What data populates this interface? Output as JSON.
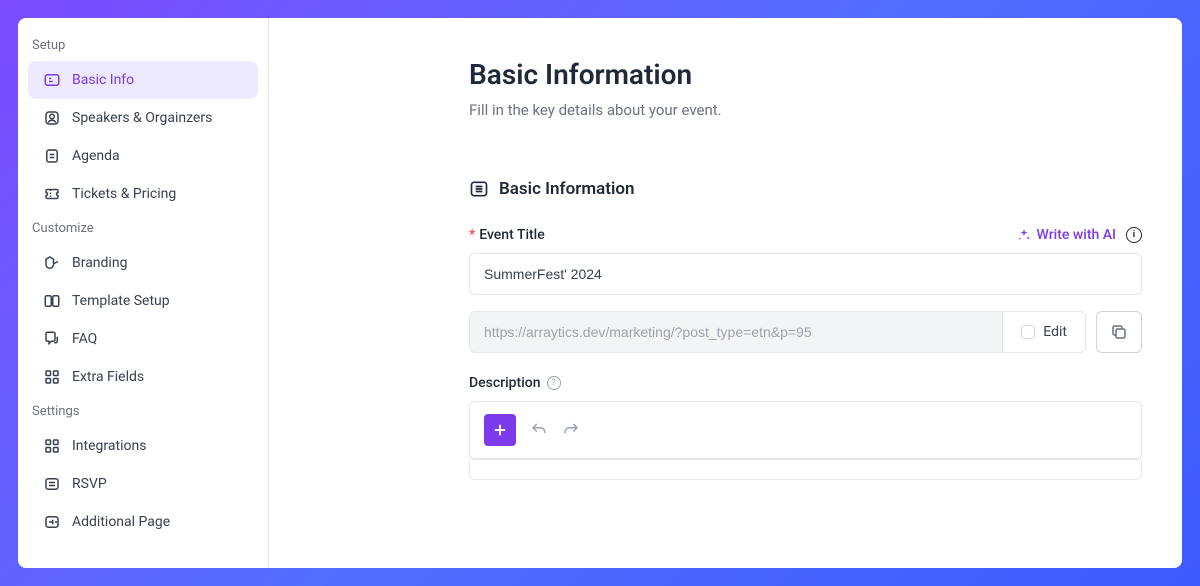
{
  "sidebar": {
    "sections": [
      {
        "header": "Setup",
        "items": [
          {
            "label": "Basic Info",
            "active": true
          },
          {
            "label": "Speakers & Orgainzers",
            "active": false
          },
          {
            "label": "Agenda",
            "active": false
          },
          {
            "label": "Tickets & Pricing",
            "active": false
          }
        ]
      },
      {
        "header": "Customize",
        "items": [
          {
            "label": "Branding",
            "active": false
          },
          {
            "label": "Template Setup",
            "active": false
          },
          {
            "label": "FAQ",
            "active": false
          },
          {
            "label": "Extra Fields",
            "active": false
          }
        ]
      },
      {
        "header": "Settings",
        "items": [
          {
            "label": "Integrations",
            "active": false
          },
          {
            "label": "RSVP",
            "active": false
          },
          {
            "label": "Additional Page",
            "active": false
          }
        ]
      }
    ]
  },
  "main": {
    "title": "Basic Information",
    "subtitle": "Fill in the key details about your event.",
    "section_title": "Basic Information",
    "event_title_label": "Event Title",
    "event_title_value": "SummerFest' 2024",
    "write_ai_label": "Write with AI",
    "url_value": "https://arraytics.dev/marketing/?post_type=etn&p=95",
    "edit_label": "Edit",
    "description_label": "Description"
  }
}
